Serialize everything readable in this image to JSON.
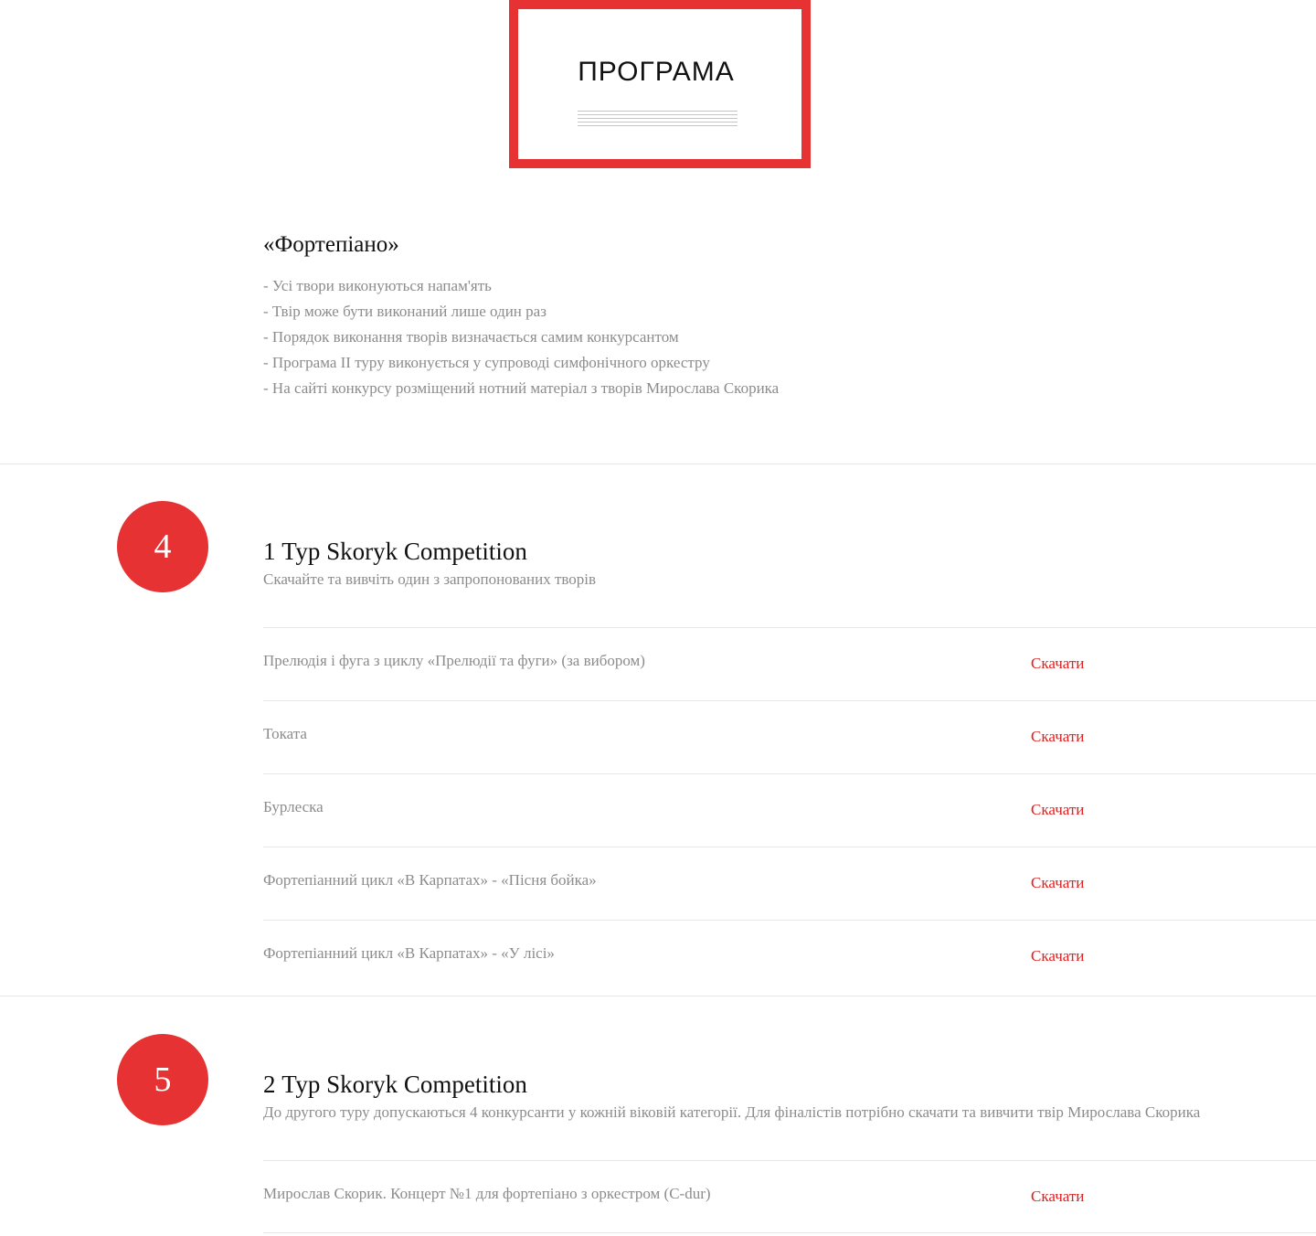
{
  "header": {
    "title": "ПРОГРАМА"
  },
  "intro": {
    "heading": "«Фортепіано»",
    "rules": [
      "- Усі твори виконуються напам'ять",
      "- Твір може бути виконаний лише один раз",
      "- Порядок виконання творів визначається самим конкурсантом",
      "- Програма II туру виконується у супроводі симфонічного оркестру",
      "- На сайті конкурсу розміщений нотний матеріал з творів Мирослава Скорика"
    ]
  },
  "rounds": [
    {
      "badge": "4",
      "title": "1 Тур Skoryk Competition",
      "description": "Скачайте та вивчіть один з запропонованих творів",
      "pieces": [
        {
          "name": "Прелюдія і фуга з циклу «Прелюдії та фуги» (за вибором)",
          "action": "Скачати"
        },
        {
          "name": "Токата",
          "action": "Скачати"
        },
        {
          "name": "Бурлеска",
          "action": "Скачати"
        },
        {
          "name": "Фортепіанний цикл «В Карпатах» - «Пісня бойка»",
          "action": "Скачати"
        },
        {
          "name": "Фортепіанний цикл «В Карпатах» - «У лісі»",
          "action": "Скачати"
        }
      ]
    },
    {
      "badge": "5",
      "title": "2 Тур Skoryk Competition",
      "description": "До другого туру допускаються 4 конкурсанти у кожній віковій категорії. Для фіналістів потрібно скачати та вивчити твір Мирослава Скорика",
      "pieces": [
        {
          "name": "Мирослав Скорик. Концерт №1 для фортепіано з оркестром (C-dur)",
          "action": "Скачати"
        }
      ]
    }
  ]
}
